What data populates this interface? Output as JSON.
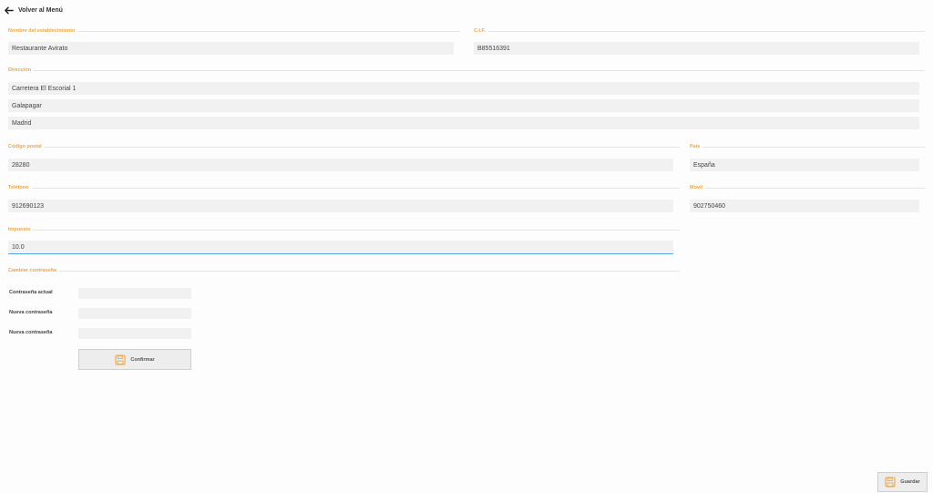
{
  "header": {
    "back_label": "Volver al Menú"
  },
  "establishment": {
    "name_legend": "Nombre del establecimiento",
    "name_value": "Restaurante Avirato",
    "cif_legend": "C.I.F.",
    "cif_value": "B85516391"
  },
  "address": {
    "legend": "Dirección",
    "line1": "Carretera El Escorial 1",
    "line2": "Galapagar",
    "line3": "Madrid"
  },
  "postal": {
    "postal_legend": "Código postal",
    "postal_value": "28280",
    "country_legend": "País",
    "country_value": "España"
  },
  "contact": {
    "phone_legend": "Teléfono",
    "phone_value": "912690123",
    "mobile_legend": "Movil",
    "mobile_value": "902750460"
  },
  "tax": {
    "legend": "Impuesto",
    "value": "10.0"
  },
  "password": {
    "legend": "Cambiar contraseña",
    "current_label": "Contraseña actual",
    "new_label": "Nueva contraseña",
    "repeat_label": "Nueva contraseña",
    "confirm_label": "Confirmar"
  },
  "footer": {
    "save_label": "Guardar"
  },
  "colors": {
    "accent": "#f0a640",
    "focus": "#5aa7e6",
    "field_bg": "#f1f1f1"
  },
  "icons": {
    "back": "arrow-left-icon",
    "save": "floppy-disk-icon"
  }
}
